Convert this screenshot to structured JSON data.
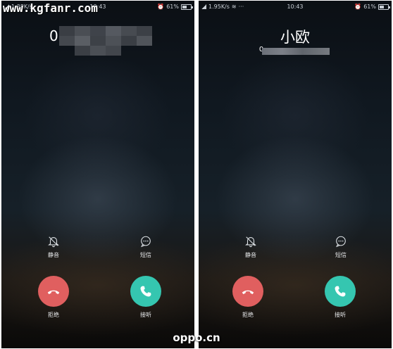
{
  "watermark": "www.kgfanr.com",
  "footer": "oppo.cn",
  "colors": {
    "decline": "#e05f5f",
    "answer": "#35c6b0"
  },
  "left_screen": {
    "status": {
      "speed": "1.38K/s",
      "time": "10:43",
      "battery": "61%"
    },
    "caller_number_prefix": "0",
    "actions": {
      "mute_label": "静音",
      "sms_label": "短信"
    },
    "buttons": {
      "decline_label": "拒绝",
      "answer_label": "接听"
    }
  },
  "right_screen": {
    "status": {
      "speed": "1.95K/s",
      "time": "10:43",
      "battery": "61%"
    },
    "caller_name": "小欧",
    "caller_number_prefix": "0",
    "actions": {
      "mute_label": "静音",
      "sms_label": "短信"
    },
    "buttons": {
      "decline_label": "拒绝",
      "answer_label": "接听"
    }
  }
}
